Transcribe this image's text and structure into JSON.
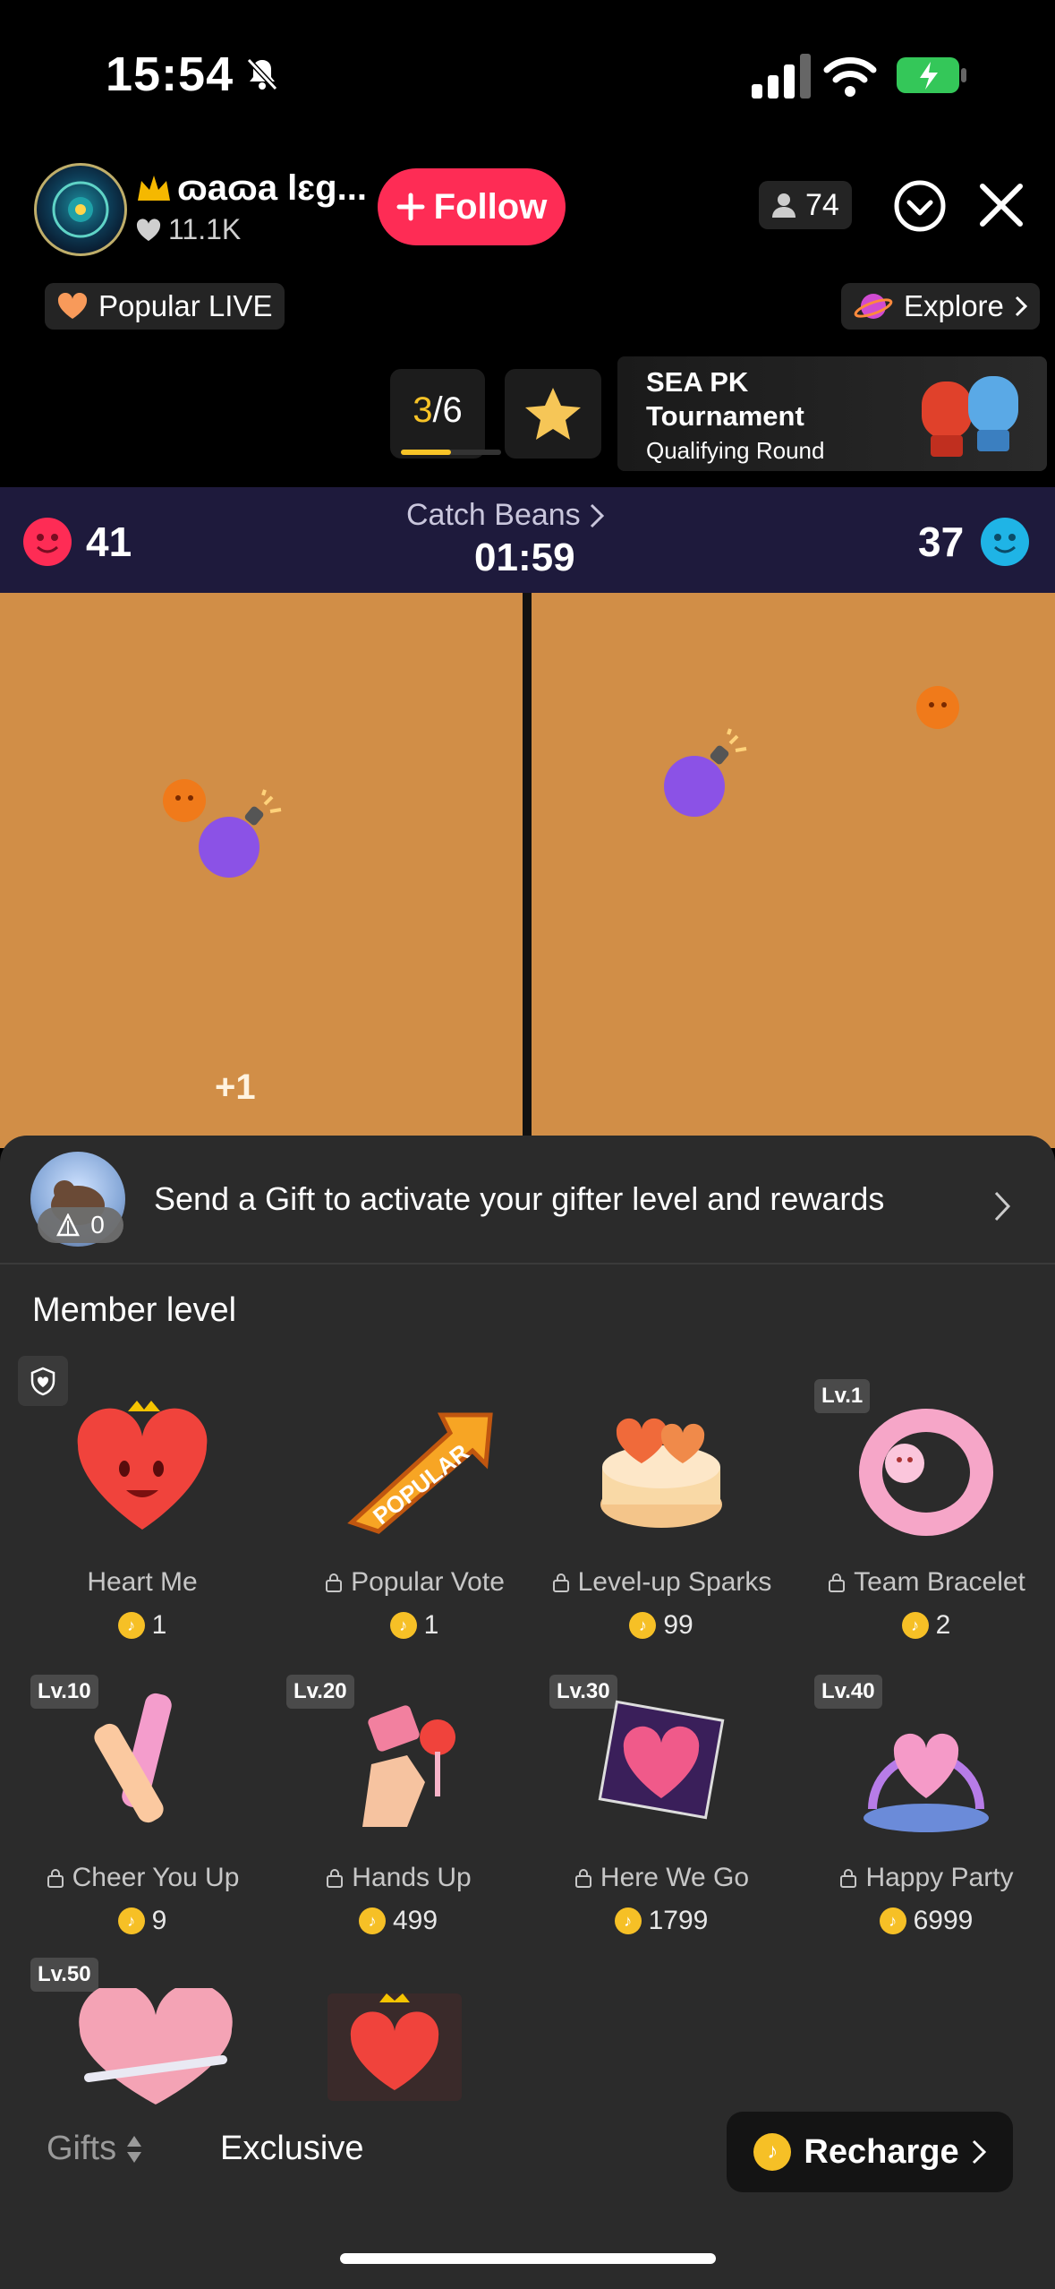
{
  "status_bar": {
    "time": "15:54"
  },
  "header": {
    "host_name": "ɷaɷa lɛg...",
    "likes": "11.1K",
    "follow_label": "Follow",
    "viewer_count": "74",
    "popular_live_label": "Popular LIVE",
    "explore_label": "Explore"
  },
  "rank": {
    "current": "3",
    "total": "/6",
    "progress": 0.5
  },
  "pk_banner": {
    "line1": "SEA PK",
    "line2": "Tournament",
    "line3": "Qualifying Round"
  },
  "game": {
    "left_score": "41",
    "right_score": "37",
    "title": "Catch Beans",
    "timer": "01:59",
    "floating_text": "+1"
  },
  "gift_sheet": {
    "gifter_level": "0",
    "message": "Send a Gift to activate your gifter level and rewards",
    "member_level_label": "Member level",
    "gifts": [
      {
        "name": "Heart Me",
        "price": "1",
        "locked": false,
        "level": ""
      },
      {
        "name": "Popular Vote",
        "price": "1",
        "locked": true,
        "level": ""
      },
      {
        "name": "Level-up Sparks",
        "price": "99",
        "locked": true,
        "level": ""
      },
      {
        "name": "Team Bracelet",
        "price": "2",
        "locked": true,
        "level": "Lv.1"
      },
      {
        "name": "Cheer You Up",
        "price": "9",
        "locked": true,
        "level": "Lv.10"
      },
      {
        "name": "Hands Up",
        "price": "499",
        "locked": true,
        "level": "Lv.20"
      },
      {
        "name": "Here We Go",
        "price": "1799",
        "locked": true,
        "level": "Lv.30"
      },
      {
        "name": "Happy Party",
        "price": "6999",
        "locked": true,
        "level": "Lv.40"
      }
    ],
    "row3_level": "Lv.50",
    "tabs": {
      "gifts": "Gifts",
      "exclusive": "Exclusive"
    },
    "recharge_label": "Recharge"
  },
  "colors": {
    "follow": "#fe2c55",
    "coin": "#f6c026",
    "game_bar": "#1e1a3c",
    "game_panel": "#d18e47",
    "battery": "#34c759",
    "left_team": "#fe2c55",
    "right_team": "#1fb4e6"
  }
}
